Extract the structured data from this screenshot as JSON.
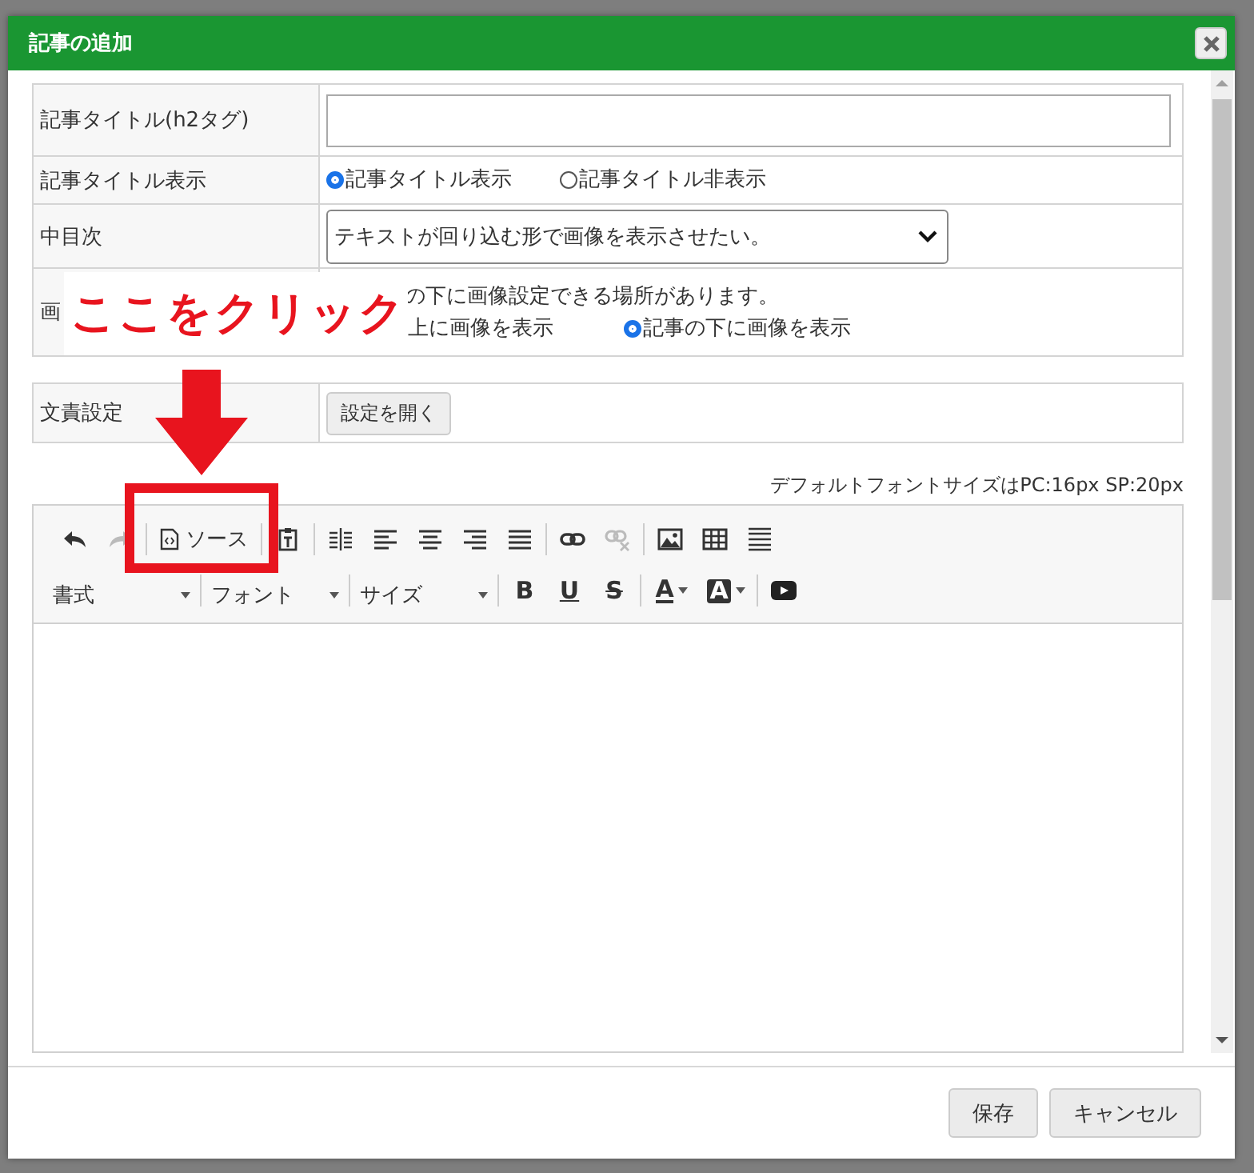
{
  "dialog": {
    "title": "記事の追加"
  },
  "form_rows": [
    {
      "kind": "text_input",
      "label": "記事タイトル(h2タグ)"
    },
    {
      "kind": "radio",
      "label": "記事タイトル表示",
      "options": [
        {
          "label": "記事タイトル表示",
          "selected": true
        },
        {
          "label": "記事タイトル非表示",
          "selected": false
        }
      ]
    },
    {
      "kind": "select",
      "label": "中目次",
      "value": "テキストが回り込む形で画像を表示させたい。"
    },
    {
      "kind": "note_radio",
      "label": "画",
      "note": "の下に画像設定できる場所があります。",
      "options": [
        {
          "label": "上に画像を表示"
        },
        {
          "label": "記事の下に画像を表示",
          "selected": true
        }
      ]
    }
  ],
  "author_row": {
    "label": "文責設定",
    "button": "設定を開く"
  },
  "font_note": "デフォルトフォントサイズはPC:16px SP:20px",
  "editor": {
    "toolbar_row_1": [
      {
        "kind": "icon",
        "disabled": false
      },
      {
        "kind": "icon",
        "disabled": true
      },
      {
        "kind": "source",
        "label": "ソース",
        "disabled": false
      },
      {
        "kind": "icon",
        "disabled": false
      },
      {
        "kind": "icon",
        "disabled": false
      },
      {
        "kind": "icon",
        "disabled": false
      },
      {
        "kind": "icon",
        "disabled": false
      },
      {
        "kind": "icon",
        "disabled": false
      },
      {
        "kind": "icon",
        "disabled": false
      },
      {
        "kind": "icon",
        "disabled": false
      },
      {
        "kind": "icon",
        "disabled": true
      },
      {
        "kind": "icon",
        "disabled": false
      },
      {
        "kind": "icon",
        "disabled": false
      },
      {
        "kind": "icon",
        "disabled": false
      }
    ],
    "dropdowns": [
      {
        "label": "書式"
      },
      {
        "label": "フォント"
      },
      {
        "label": "サイズ"
      }
    ],
    "format_buttons": [
      {
        "kind": "bold",
        "label": "B"
      },
      {
        "kind": "underline",
        "label": "U"
      },
      {
        "kind": "strike",
        "label": "S"
      },
      {
        "kind": "text_color",
        "label": "A"
      },
      {
        "kind": "background_color",
        "label": "A"
      }
    ]
  },
  "footer": {
    "buttons": [
      {
        "label": "保存"
      },
      {
        "label": "キャンセル"
      }
    ]
  },
  "annotation": {
    "text": "ここをクリック"
  }
}
